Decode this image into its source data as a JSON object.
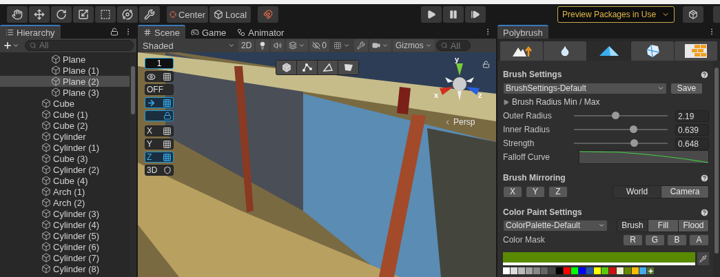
{
  "toolbar": {
    "tools": [
      {
        "kind": "hand"
      },
      {
        "kind": "move"
      },
      {
        "kind": "rotate"
      },
      {
        "kind": "scale"
      },
      {
        "kind": "rect"
      },
      {
        "kind": "transform"
      },
      {
        "kind": "custom"
      }
    ],
    "pivot": [
      {
        "label": "Center",
        "kind": "pivot"
      },
      {
        "label": "Local",
        "kind": "space"
      }
    ],
    "play_controls": [
      {
        "kind": "play"
      },
      {
        "kind": "pause"
      },
      {
        "kind": "step"
      }
    ],
    "preview_packages": "Preview Packages in Use"
  },
  "hierarchy": {
    "title": "Hierarchy",
    "search": {
      "placeholder": "All"
    },
    "items": [
      {
        "children": [
          {
            "label": "Plane",
            "selected": false
          },
          {
            "label": "Plane (1)",
            "selected": false
          },
          {
            "label": "Plane (2)",
            "selected": true
          },
          {
            "label": "Plane (3)",
            "selected": false
          }
        ]
      },
      {
        "label": "Cube",
        "selected": false
      },
      {
        "label": "Cube (1)",
        "selected": false
      },
      {
        "label": "Cube (2)",
        "selected": false
      },
      {
        "label": "Cylinder",
        "selected": false
      },
      {
        "label": "Cylinder (1)",
        "selected": false
      },
      {
        "label": "Cube (3)",
        "selected": false
      },
      {
        "label": "Cylinder (2)",
        "selected": false
      },
      {
        "label": "Cube (4)",
        "selected": false
      },
      {
        "label": "Arch (1)",
        "selected": false
      },
      {
        "label": "Arch (2)",
        "selected": false
      },
      {
        "label": "Cylinder (3)",
        "selected": false
      },
      {
        "label": "Cylinder (4)",
        "selected": false
      },
      {
        "label": "Cylinder (5)",
        "selected": false
      },
      {
        "label": "Cylinder (6)",
        "selected": false
      },
      {
        "label": "Cylinder (7)",
        "selected": false
      },
      {
        "label": "Cylinder (8)",
        "selected": false
      }
    ]
  },
  "scene": {
    "tabs": [
      {
        "label": "Scene",
        "kind": "scene",
        "selected": true
      },
      {
        "label": "Game",
        "kind": "game",
        "selected": false
      },
      {
        "label": "Animator",
        "kind": "animator",
        "selected": false
      }
    ],
    "shading": "Shaded",
    "grid_on": false,
    "mode_2d": "2D",
    "hidden_count": "0",
    "gizmos": "Gizmos",
    "search": {
      "placeholder": "All"
    },
    "overlay": {
      "grid_size": "1",
      "snap_toggle": "OFF",
      "axes": [
        {
          "label": "X",
          "selected": false
        },
        {
          "label": "Y",
          "selected": false
        },
        {
          "label": "Z",
          "selected": true
        }
      ],
      "view_3d": "3D",
      "select_modes": [
        {
          "kind": "object"
        },
        {
          "kind": "vertex"
        },
        {
          "kind": "edge"
        },
        {
          "kind": "face"
        }
      ],
      "gizmo_axes": {
        "x": "x",
        "y": "y",
        "z": "z"
      },
      "projection": "Persp"
    }
  },
  "polybrush": {
    "title": "Polybrush",
    "modes": [
      {
        "kind": "sculpt",
        "selected": false
      },
      {
        "kind": "smooth",
        "selected": false
      },
      {
        "kind": "color",
        "selected": true
      },
      {
        "kind": "prefab",
        "selected": false
      },
      {
        "kind": "texture",
        "selected": false
      }
    ],
    "brush_settings": {
      "title": "Brush Settings",
      "preset": "BrushSettings-Default",
      "save": "Save",
      "radius_toggle": "Brush Radius Min / Max",
      "sliders": [
        {
          "label": "Outer Radius",
          "level": 0.44,
          "reading": "2.19"
        },
        {
          "label": "Inner Radius",
          "level": 0.63,
          "reading": "0.639"
        },
        {
          "label": "Strength",
          "level": 0.64,
          "reading": "0.648"
        }
      ],
      "falloff_label": "Falloff Curve"
    },
    "mirroring": {
      "title": "Brush Mirroring",
      "axes": [
        "X",
        "Y",
        "Z"
      ],
      "spaces": [
        {
          "label": "World",
          "selected": true
        },
        {
          "label": "Camera",
          "selected": false
        }
      ]
    },
    "color_paint": {
      "title": "Color Paint Settings",
      "palette": "ColorPalette-Default",
      "modes": [
        {
          "label": "Brush",
          "selected": true
        },
        {
          "label": "Fill",
          "selected": false
        },
        {
          "label": "Flood",
          "selected": false
        }
      ],
      "mask_label": "Color Mask",
      "mask": [
        "R",
        "G",
        "B",
        "A"
      ],
      "swatches": [
        {
          "color": "#ffffff"
        },
        {
          "color": "#dddddd"
        },
        {
          "color": "#bbbbbb"
        },
        {
          "color": "#a0a0a0"
        },
        {
          "color": "#888888"
        },
        {
          "color": "#666666"
        },
        {
          "color": "#444444"
        },
        {
          "color": "#000000"
        },
        {
          "color": "#ff0000"
        },
        {
          "color": "#00ff00"
        },
        {
          "color": "#0000ff"
        },
        {
          "color": "#2255aa"
        },
        {
          "color": "#ffff00"
        },
        {
          "color": "#55cc11"
        },
        {
          "color": "#cc1111"
        },
        {
          "color": "#eeeecc"
        },
        {
          "color": "#668800"
        },
        {
          "color": "#ffbb00"
        },
        {
          "color": "#44aaee"
        }
      ]
    }
  }
}
